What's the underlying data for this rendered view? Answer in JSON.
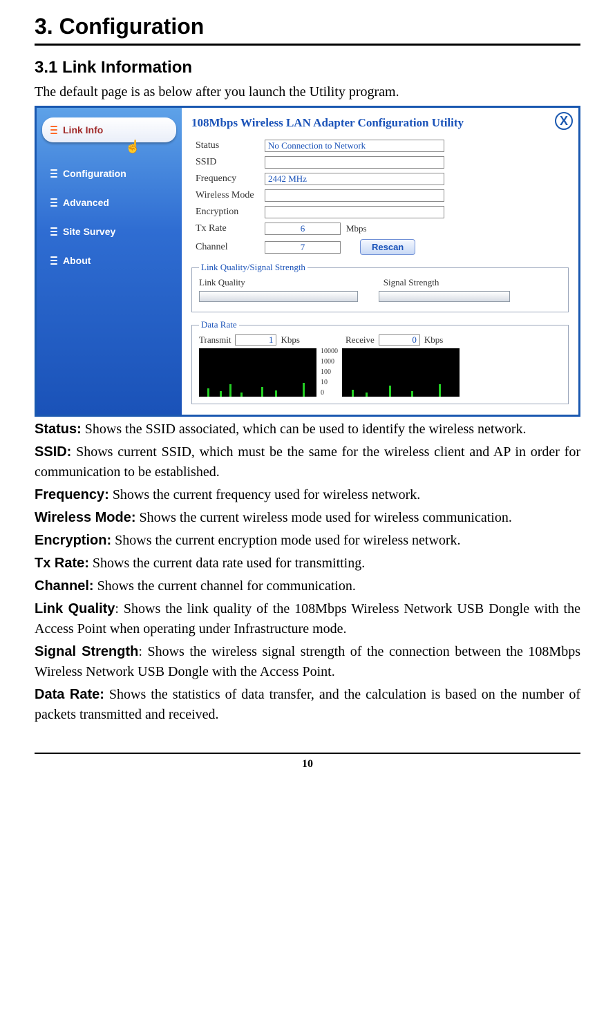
{
  "headings": {
    "main": "3. Configuration",
    "sub": "3.1 Link Information",
    "intro": "The default page is as below after you launch the Utility program."
  },
  "window": {
    "title": "108Mbps Wireless LAN Adapter Configuration Utility",
    "tabs": [
      "Link Info",
      "Configuration",
      "Advanced",
      "Site Survey",
      "About"
    ],
    "fields": {
      "status_label": "Status",
      "status_value": "No Connection to Network",
      "ssid_label": "SSID",
      "ssid_value": "",
      "freq_label": "Frequency",
      "freq_value": "2442 MHz",
      "mode_label": "Wireless Mode",
      "mode_value": "",
      "enc_label": "Encryption",
      "enc_value": "",
      "tx_label": "Tx Rate",
      "tx_value": "6",
      "tx_unit": "Mbps",
      "ch_label": "Channel",
      "ch_value": "7",
      "rescan": "Rescan"
    },
    "lq": {
      "legend": "Link Quality/Signal Strength",
      "lq_label": "Link Quality",
      "ss_label": "Signal Strength"
    },
    "dr": {
      "legend": "Data Rate",
      "transmit_label": "Transmit",
      "transmit_value": "1",
      "receive_label": "Receive",
      "receive_value": "0",
      "kbps": "Kbps",
      "scale": [
        "10000",
        "1000",
        "100",
        "10",
        "0"
      ]
    }
  },
  "defs": [
    {
      "term": "Status:",
      "text": " Shows the SSID associated, which can be used to identify the wireless network."
    },
    {
      "term": "SSID:",
      "text": " Shows current SSID, which must be the same for the wireless client and AP in order for communication to be established."
    },
    {
      "term": "Frequency:",
      "text": " Shows the current frequency used for wireless network."
    },
    {
      "term": "Wireless Mode:",
      "text": " Shows the current wireless mode used for wireless communication."
    },
    {
      "term": "Encryption:",
      "text": " Shows the current encryption mode used for wireless network."
    },
    {
      "term": "Tx Rate:",
      "text": " Shows the current data rate used for transmitting."
    },
    {
      "term": "Channel:",
      "text": " Shows the current channel for communication."
    },
    {
      "term": "Link Quality",
      "text": ": Shows the link quality of the 108Mbps Wireless Network USB Dongle with the Access Point when operating under Infrastructure mode."
    },
    {
      "term": "Signal Strength",
      "text": ": Shows the wireless signal strength of the connection between the 108Mbps Wireless Network USB Dongle with the Access Point."
    },
    {
      "term": "Data Rate:",
      "text": " Shows the statistics of data transfer, and the calculation is based on the number of packets transmitted and received."
    }
  ],
  "page_number": "10"
}
